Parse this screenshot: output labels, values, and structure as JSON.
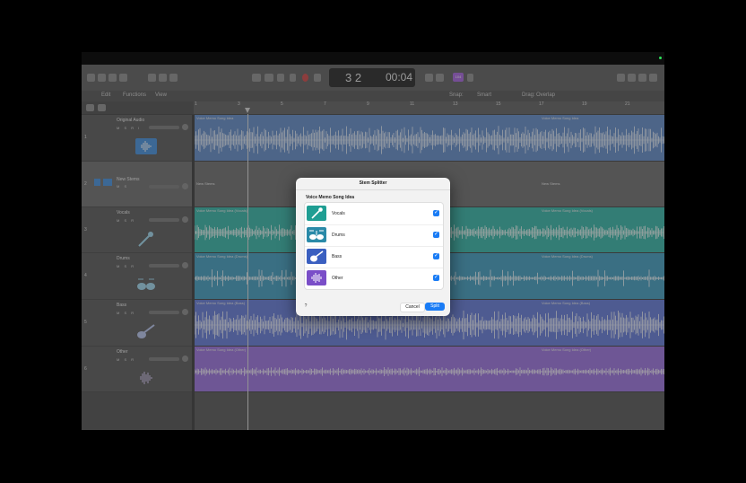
{
  "toolbar": {
    "lcd_bars": "3 2",
    "lcd_time": "00:04",
    "badge": "104"
  },
  "menubar": {
    "edit": "Edit",
    "functions": "Functions",
    "view": "View",
    "snap_label": "Snap:",
    "snap_value": "Smart",
    "drag_label": "Drag:",
    "drag_value": "Overlap"
  },
  "ruler": {
    "ticks": [
      "1",
      "3",
      "5",
      "7",
      "9",
      "11",
      "13",
      "15",
      "17",
      "19",
      "21"
    ]
  },
  "tracks": [
    {
      "num": "1",
      "name": "Original Audio",
      "msr": "M S R I",
      "region": "Voice Memo Song Idea",
      "region2": "Voice Memo Song Idea"
    },
    {
      "num": "2",
      "name": "New Stems",
      "msr": "M S",
      "region": "New Stems",
      "region2": "New Stems"
    },
    {
      "num": "3",
      "name": "Vocals",
      "msr": "M S R",
      "region": "Voice Memo Song Idea (Vocals)",
      "region2": "Voice Memo Song Idea (Vocals)"
    },
    {
      "num": "4",
      "name": "Drums",
      "msr": "M S R",
      "region": "Voice Memo Song Idea (Drums)",
      "region2": "Voice Memo Song Idea (Drums)"
    },
    {
      "num": "5",
      "name": "Bass",
      "msr": "M S R",
      "region": "Voice Memo Song Idea (Bass)",
      "region2": "Voice Memo Song Idea (Bass)"
    },
    {
      "num": "6",
      "name": "Other",
      "msr": "M S R",
      "region": "Voice Memo Song Idea (Other)",
      "region2": "Voice Memo Song Idea (Other)"
    }
  ],
  "dialog": {
    "title": "Stem Splitter",
    "subtitle": "Voice Memo Song Idea",
    "items": [
      {
        "label": "Vocals",
        "icon": "microphone-icon",
        "checked": true,
        "color": "#1f9e93"
      },
      {
        "label": "Drums",
        "icon": "drums-icon",
        "checked": true,
        "color": "#2a8aa8"
      },
      {
        "label": "Bass",
        "icon": "guitar-icon",
        "checked": true,
        "color": "#3a5fc0"
      },
      {
        "label": "Other",
        "icon": "waveform-icon",
        "checked": true,
        "color": "#7a4ec8"
      }
    ],
    "help": "?",
    "cancel": "Cancel",
    "split": "Split"
  },
  "colors": {
    "original": "#5e89c8",
    "vocals": "#2fb5a6",
    "drums": "#3a9cc0",
    "bass": "#6076d8",
    "other": "#9a6ee0",
    "accent": "#1a7cf5"
  }
}
